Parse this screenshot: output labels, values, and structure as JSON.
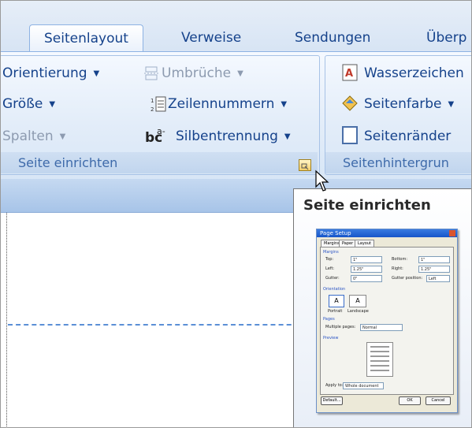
{
  "tabs": [
    {
      "label": "Seitenlayout",
      "active": true
    },
    {
      "label": "Verweise"
    },
    {
      "label": "Sendungen"
    },
    {
      "label": "Überp"
    }
  ],
  "group_seite": {
    "label": "Seite einrichten",
    "orientierung": "Orientierung",
    "umbrueche": "Umbrüche",
    "groesse": "Größe",
    "zeilennummern": "Zeilennummern",
    "spalten": "Spalten",
    "silbentrennung": "Silbentrennung"
  },
  "group_hintergrund": {
    "label": "Seitenhintergrun",
    "wasserzeichen": "Wasserzeichen",
    "seitenfarbe": "Seitenfarbe",
    "seitenraender": "Seitenränder"
  },
  "tooltip": {
    "title": "Seite einrichten",
    "dialog": {
      "title": "Page Setup",
      "tabs": [
        "Margins",
        "Paper",
        "Layout"
      ],
      "section_margins": "Margins",
      "top_label": "Top:",
      "top_value": "1\"",
      "bottom_label": "Bottom:",
      "bottom_value": "1\"",
      "left_label": "Left:",
      "left_value": "1.25\"",
      "right_label": "Right:",
      "right_value": "1.25\"",
      "gutter_label": "Gutter:",
      "gutter_value": "0\"",
      "gutter_pos_label": "Gutter position:",
      "gutter_pos_value": "Left",
      "section_orientation": "Orientation",
      "portrait": "Portrait",
      "landscape": "Landscape",
      "section_pages": "Pages",
      "multiple_pages_label": "Multiple pages:",
      "multiple_pages_value": "Normal",
      "section_preview": "Preview",
      "apply_label": "Apply to:",
      "apply_value": "Whole document",
      "default_button": "Default...",
      "ok_button": "OK",
      "cancel_button": "Cancel"
    }
  },
  "colors": {
    "accent": "#15428b",
    "ribbon": "#dbe7f7",
    "dashes": "#5b8fd6"
  }
}
